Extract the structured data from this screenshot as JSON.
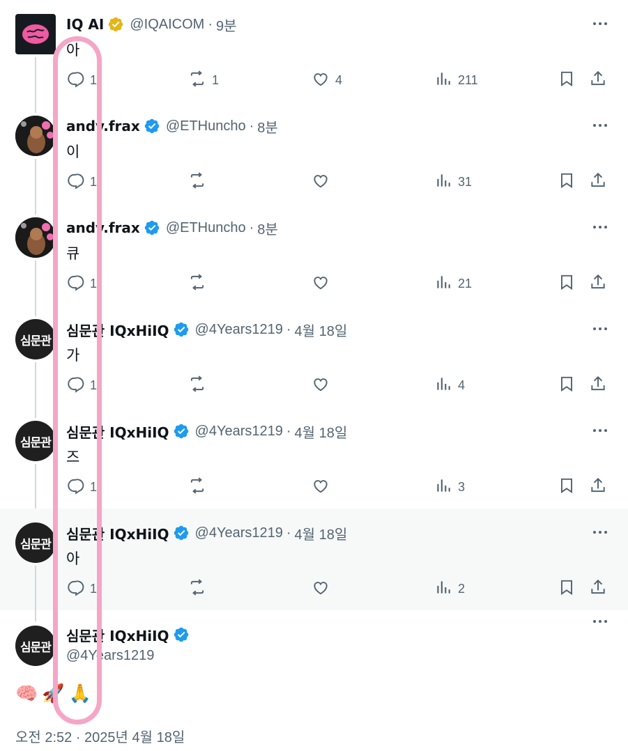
{
  "tweets": [
    {
      "name": "IQ AI",
      "badge": "gold",
      "handle": "@IQAICOM",
      "time": "9분",
      "text": "아",
      "replies": "1",
      "reposts": "1",
      "likes": "4",
      "views": "211",
      "avatar": "brain-logo",
      "highlighted": false
    },
    {
      "name": "andy.frax",
      "badge": "blue",
      "handle": "@ETHuncho",
      "time": "8분",
      "text": "이",
      "replies": "1",
      "reposts": "",
      "likes": "",
      "views": "31",
      "avatar": "photo",
      "highlighted": false
    },
    {
      "name": "andy.frax",
      "badge": "blue",
      "handle": "@ETHuncho",
      "time": "8분",
      "text": "큐",
      "replies": "1",
      "reposts": "",
      "likes": "",
      "views": "21",
      "avatar": "photo",
      "highlighted": false
    },
    {
      "name": "심문관 IQxHiIQ",
      "badge": "blue",
      "handle": "@4Years1219",
      "time": "4월 18일",
      "text": "가",
      "replies": "1",
      "reposts": "",
      "likes": "",
      "views": "4",
      "avatar": "심문관",
      "highlighted": false
    },
    {
      "name": "심문관 IQxHiIQ",
      "badge": "blue",
      "handle": "@4Years1219",
      "time": "4월 18일",
      "text": "즈",
      "replies": "1",
      "reposts": "",
      "likes": "",
      "views": "3",
      "avatar": "심문관",
      "highlighted": false
    },
    {
      "name": "심문관 IQxHiIQ",
      "badge": "blue",
      "handle": "@4Years1219",
      "time": "4월 18일",
      "text": "아",
      "replies": "1",
      "reposts": "",
      "likes": "",
      "views": "2",
      "avatar": "심문관",
      "highlighted": true
    }
  ],
  "main_tweet": {
    "name": "심문관 IQxHiIQ",
    "handle": "@4Years1219",
    "avatar": "심문관",
    "emojis": [
      "🧠",
      "🚀",
      "🙏"
    ],
    "timestamp": "오전 2:52 · 2025년 4월 18일"
  },
  "colors": {
    "text": "#0f1419",
    "muted": "#536471",
    "blue_badge": "#1d9bf0",
    "gold_badge": "#e2b719",
    "highlight_bg": "#f7f9f9",
    "annotation": "#f5a6c6"
  }
}
